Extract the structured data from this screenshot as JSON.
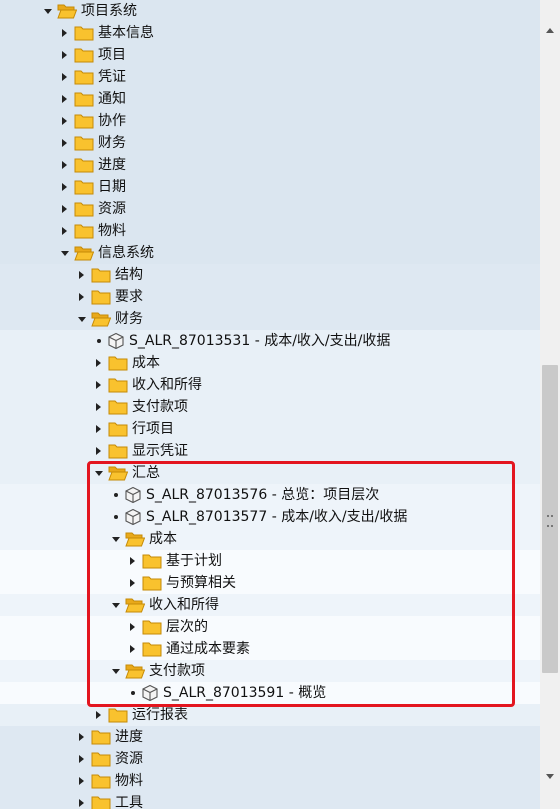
{
  "tree": [
    {
      "label": "项目系统",
      "level": 0,
      "state": "expanded",
      "icon": "folder-open-icon",
      "band": "a"
    },
    {
      "label": "基本信息",
      "level": 1,
      "state": "collapsed",
      "icon": "folder-icon",
      "band": "a"
    },
    {
      "label": "项目",
      "level": 1,
      "state": "collapsed",
      "icon": "folder-icon",
      "band": "a"
    },
    {
      "label": "凭证",
      "level": 1,
      "state": "collapsed",
      "icon": "folder-icon",
      "band": "a"
    },
    {
      "label": "通知",
      "level": 1,
      "state": "collapsed",
      "icon": "folder-icon",
      "band": "a"
    },
    {
      "label": "协作",
      "level": 1,
      "state": "collapsed",
      "icon": "folder-icon",
      "band": "a"
    },
    {
      "label": "财务",
      "level": 1,
      "state": "collapsed",
      "icon": "folder-icon",
      "band": "a"
    },
    {
      "label": "进度",
      "level": 1,
      "state": "collapsed",
      "icon": "folder-icon",
      "band": "a"
    },
    {
      "label": "日期",
      "level": 1,
      "state": "collapsed",
      "icon": "folder-icon",
      "band": "a"
    },
    {
      "label": "资源",
      "level": 1,
      "state": "collapsed",
      "icon": "folder-icon",
      "band": "a"
    },
    {
      "label": "物料",
      "level": 1,
      "state": "collapsed",
      "icon": "folder-icon",
      "band": "a"
    },
    {
      "label": "信息系统",
      "level": 1,
      "state": "expanded",
      "icon": "folder-open-icon",
      "band": "a"
    },
    {
      "label": "结构",
      "level": 2,
      "state": "collapsed",
      "icon": "folder-icon",
      "band": "b"
    },
    {
      "label": "要求",
      "level": 2,
      "state": "collapsed",
      "icon": "folder-icon",
      "band": "b"
    },
    {
      "label": "财务",
      "level": 2,
      "state": "expanded",
      "icon": "folder-open-icon",
      "band": "b"
    },
    {
      "label": "S_ALR_87013531 - 成本/收入/支出/收据",
      "level": 3,
      "state": "leaf",
      "icon": "report-cube-icon",
      "band": "c"
    },
    {
      "label": "成本",
      "level": 3,
      "state": "collapsed",
      "icon": "folder-icon",
      "band": "c"
    },
    {
      "label": "收入和所得",
      "level": 3,
      "state": "collapsed",
      "icon": "folder-icon",
      "band": "c"
    },
    {
      "label": "支付款项",
      "level": 3,
      "state": "collapsed",
      "icon": "folder-icon",
      "band": "c"
    },
    {
      "label": "行项目",
      "level": 3,
      "state": "collapsed",
      "icon": "folder-icon",
      "band": "c"
    },
    {
      "label": "显示凭证",
      "level": 3,
      "state": "collapsed",
      "icon": "folder-icon",
      "band": "c"
    },
    {
      "label": "汇总",
      "level": 3,
      "state": "expanded",
      "icon": "folder-open-icon",
      "band": "c"
    },
    {
      "label": "S_ALR_87013576 - 总览：项目层次",
      "level": 4,
      "state": "leaf",
      "icon": "report-cube-icon",
      "band": "d"
    },
    {
      "label": "S_ALR_87013577 - 成本/收入/支出/收据",
      "level": 4,
      "state": "leaf",
      "icon": "report-cube-icon",
      "band": "d"
    },
    {
      "label": "成本",
      "level": 4,
      "state": "expanded",
      "icon": "folder-open-icon",
      "band": "d"
    },
    {
      "label": "基于计划",
      "level": 5,
      "state": "collapsed",
      "icon": "folder-icon",
      "band": "e"
    },
    {
      "label": "与预算相关",
      "level": 5,
      "state": "collapsed",
      "icon": "folder-icon",
      "band": "e"
    },
    {
      "label": "收入和所得",
      "level": 4,
      "state": "expanded",
      "icon": "folder-open-icon",
      "band": "d"
    },
    {
      "label": "层次的",
      "level": 5,
      "state": "collapsed",
      "icon": "folder-icon",
      "band": "e"
    },
    {
      "label": "通过成本要素",
      "level": 5,
      "state": "collapsed",
      "icon": "folder-icon",
      "band": "e"
    },
    {
      "label": "支付款项",
      "level": 4,
      "state": "expanded",
      "icon": "folder-open-icon",
      "band": "d"
    },
    {
      "label": "S_ALR_87013591 - 概览",
      "level": 5,
      "state": "leaf",
      "icon": "report-cube-icon",
      "band": "e"
    },
    {
      "label": "运行报表",
      "level": 3,
      "state": "collapsed",
      "icon": "folder-icon",
      "band": "c"
    },
    {
      "label": "进度",
      "level": 2,
      "state": "collapsed",
      "icon": "folder-icon",
      "band": "b"
    },
    {
      "label": "资源",
      "level": 2,
      "state": "collapsed",
      "icon": "folder-icon",
      "band": "b"
    },
    {
      "label": "物料",
      "level": 2,
      "state": "collapsed",
      "icon": "folder-icon",
      "band": "b"
    },
    {
      "label": "工具",
      "level": 2,
      "state": "collapsed",
      "icon": "folder-icon",
      "band": "b"
    }
  ],
  "colors": {
    "band_a": "#dbe6f0",
    "band_b": "#dee8f2",
    "band_c": "#e8f0f7",
    "band_d": "#eef4fa",
    "band_e": "#f8fbfe",
    "folder_fill": "#f9c22e",
    "folder_stroke": "#c58a06",
    "highlight": "#e3151f"
  }
}
